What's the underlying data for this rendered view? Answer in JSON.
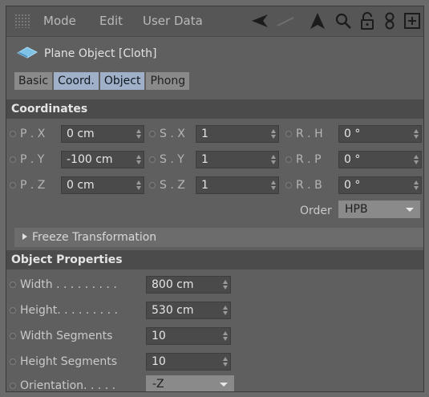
{
  "menubar": {
    "items": [
      "Mode",
      "Edit",
      "User Data"
    ],
    "icons": [
      "back-arrow-icon",
      "pointer-icon",
      "search-icon",
      "lock-icon",
      "link-icon",
      "new-panel-icon"
    ]
  },
  "object": {
    "title": "Plane Object [Cloth]",
    "icon": "plane-icon"
  },
  "tabs": [
    {
      "label": "Basic",
      "active": false
    },
    {
      "label": "Coord.",
      "active": true
    },
    {
      "label": "Object",
      "active": true
    },
    {
      "label": "Phong",
      "active": false
    }
  ],
  "coordinates": {
    "header": "Coordinates",
    "position": [
      {
        "label": "P . X",
        "value": "0 cm"
      },
      {
        "label": "P . Y",
        "value": "-100 cm"
      },
      {
        "label": "P . Z",
        "value": "0 cm"
      }
    ],
    "scale": [
      {
        "label": "S . X",
        "value": "1"
      },
      {
        "label": "S . Y",
        "value": "1"
      },
      {
        "label": "S . Z",
        "value": "1"
      }
    ],
    "rotation": [
      {
        "label": "R . H",
        "value": "0 °"
      },
      {
        "label": "R . P",
        "value": "0 °"
      },
      {
        "label": "R . B",
        "value": "0 °"
      }
    ],
    "order_label": "Order",
    "order_value": "HPB",
    "freeze": "Freeze Transformation"
  },
  "object_properties": {
    "header": "Object Properties",
    "width_label": "Width . . . . . . . . .",
    "width_value": "800 cm",
    "height_label": "Height. . . . . . . . .",
    "height_value": "530 cm",
    "width_segments_label": "Width Segments",
    "width_segments_value": "10",
    "height_segments_label": "Height Segments",
    "height_segments_value": "10",
    "orientation_label": "Orientation. . . . .",
    "orientation_value": "-Z"
  }
}
